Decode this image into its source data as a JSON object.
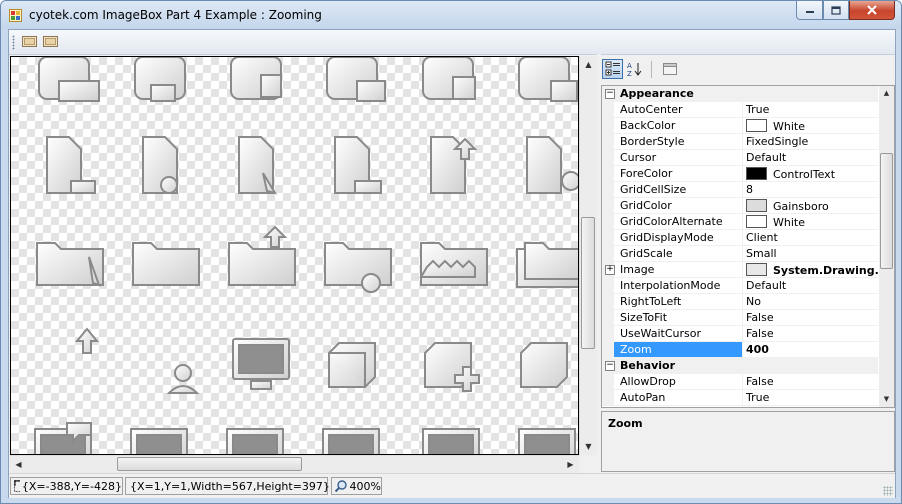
{
  "window": {
    "title": "cyotek.com ImageBox Part 4 Example : Zooming"
  },
  "toolbar": {
    "buttons": [
      {
        "name": "toolbar-button-1",
        "icon": "image-frame-icon"
      },
      {
        "name": "toolbar-button-2",
        "icon": "image-frame-icon"
      }
    ]
  },
  "property_grid": {
    "categories": [
      {
        "label": "Appearance",
        "expanded": true,
        "properties": [
          {
            "name": "AutoCenter",
            "value": "True"
          },
          {
            "name": "BackColor",
            "value": "White",
            "swatch": "#ffffff"
          },
          {
            "name": "BorderStyle",
            "value": "FixedSingle"
          },
          {
            "name": "Cursor",
            "value": "Default"
          },
          {
            "name": "ForeColor",
            "value": "ControlText",
            "swatch": "#000000"
          },
          {
            "name": "GridCellSize",
            "value": "8"
          },
          {
            "name": "GridColor",
            "value": "Gainsboro",
            "swatch": "#dcdcdc"
          },
          {
            "name": "GridColorAlternate",
            "value": "White",
            "swatch": "#ffffff"
          },
          {
            "name": "GridDisplayMode",
            "value": "Client"
          },
          {
            "name": "GridScale",
            "value": "Small"
          },
          {
            "name": "Image",
            "value": "System.Drawing.Bit",
            "swatch": "#e8e8e8",
            "bold": true,
            "expandable": true
          },
          {
            "name": "InterpolationMode",
            "value": "Default"
          },
          {
            "name": "RightToLeft",
            "value": "No"
          },
          {
            "name": "SizeToFit",
            "value": "False"
          },
          {
            "name": "UseWaitCursor",
            "value": "False"
          },
          {
            "name": "Zoom",
            "value": "400",
            "bold": true,
            "selected": true
          }
        ]
      },
      {
        "label": "Behavior",
        "expanded": true,
        "properties": [
          {
            "name": "AllowDrop",
            "value": "False"
          },
          {
            "name": "AutoPan",
            "value": "True"
          }
        ]
      }
    ],
    "help": {
      "title": "Zoom",
      "description": ""
    }
  },
  "status": {
    "cursor": "{X=-388,Y=-428}",
    "selection": "{X=1,Y=1,Width=567,Height=397}",
    "zoom": "400%"
  },
  "colors": {
    "selection": "#3399ff",
    "checker": "#e3e3e3"
  }
}
